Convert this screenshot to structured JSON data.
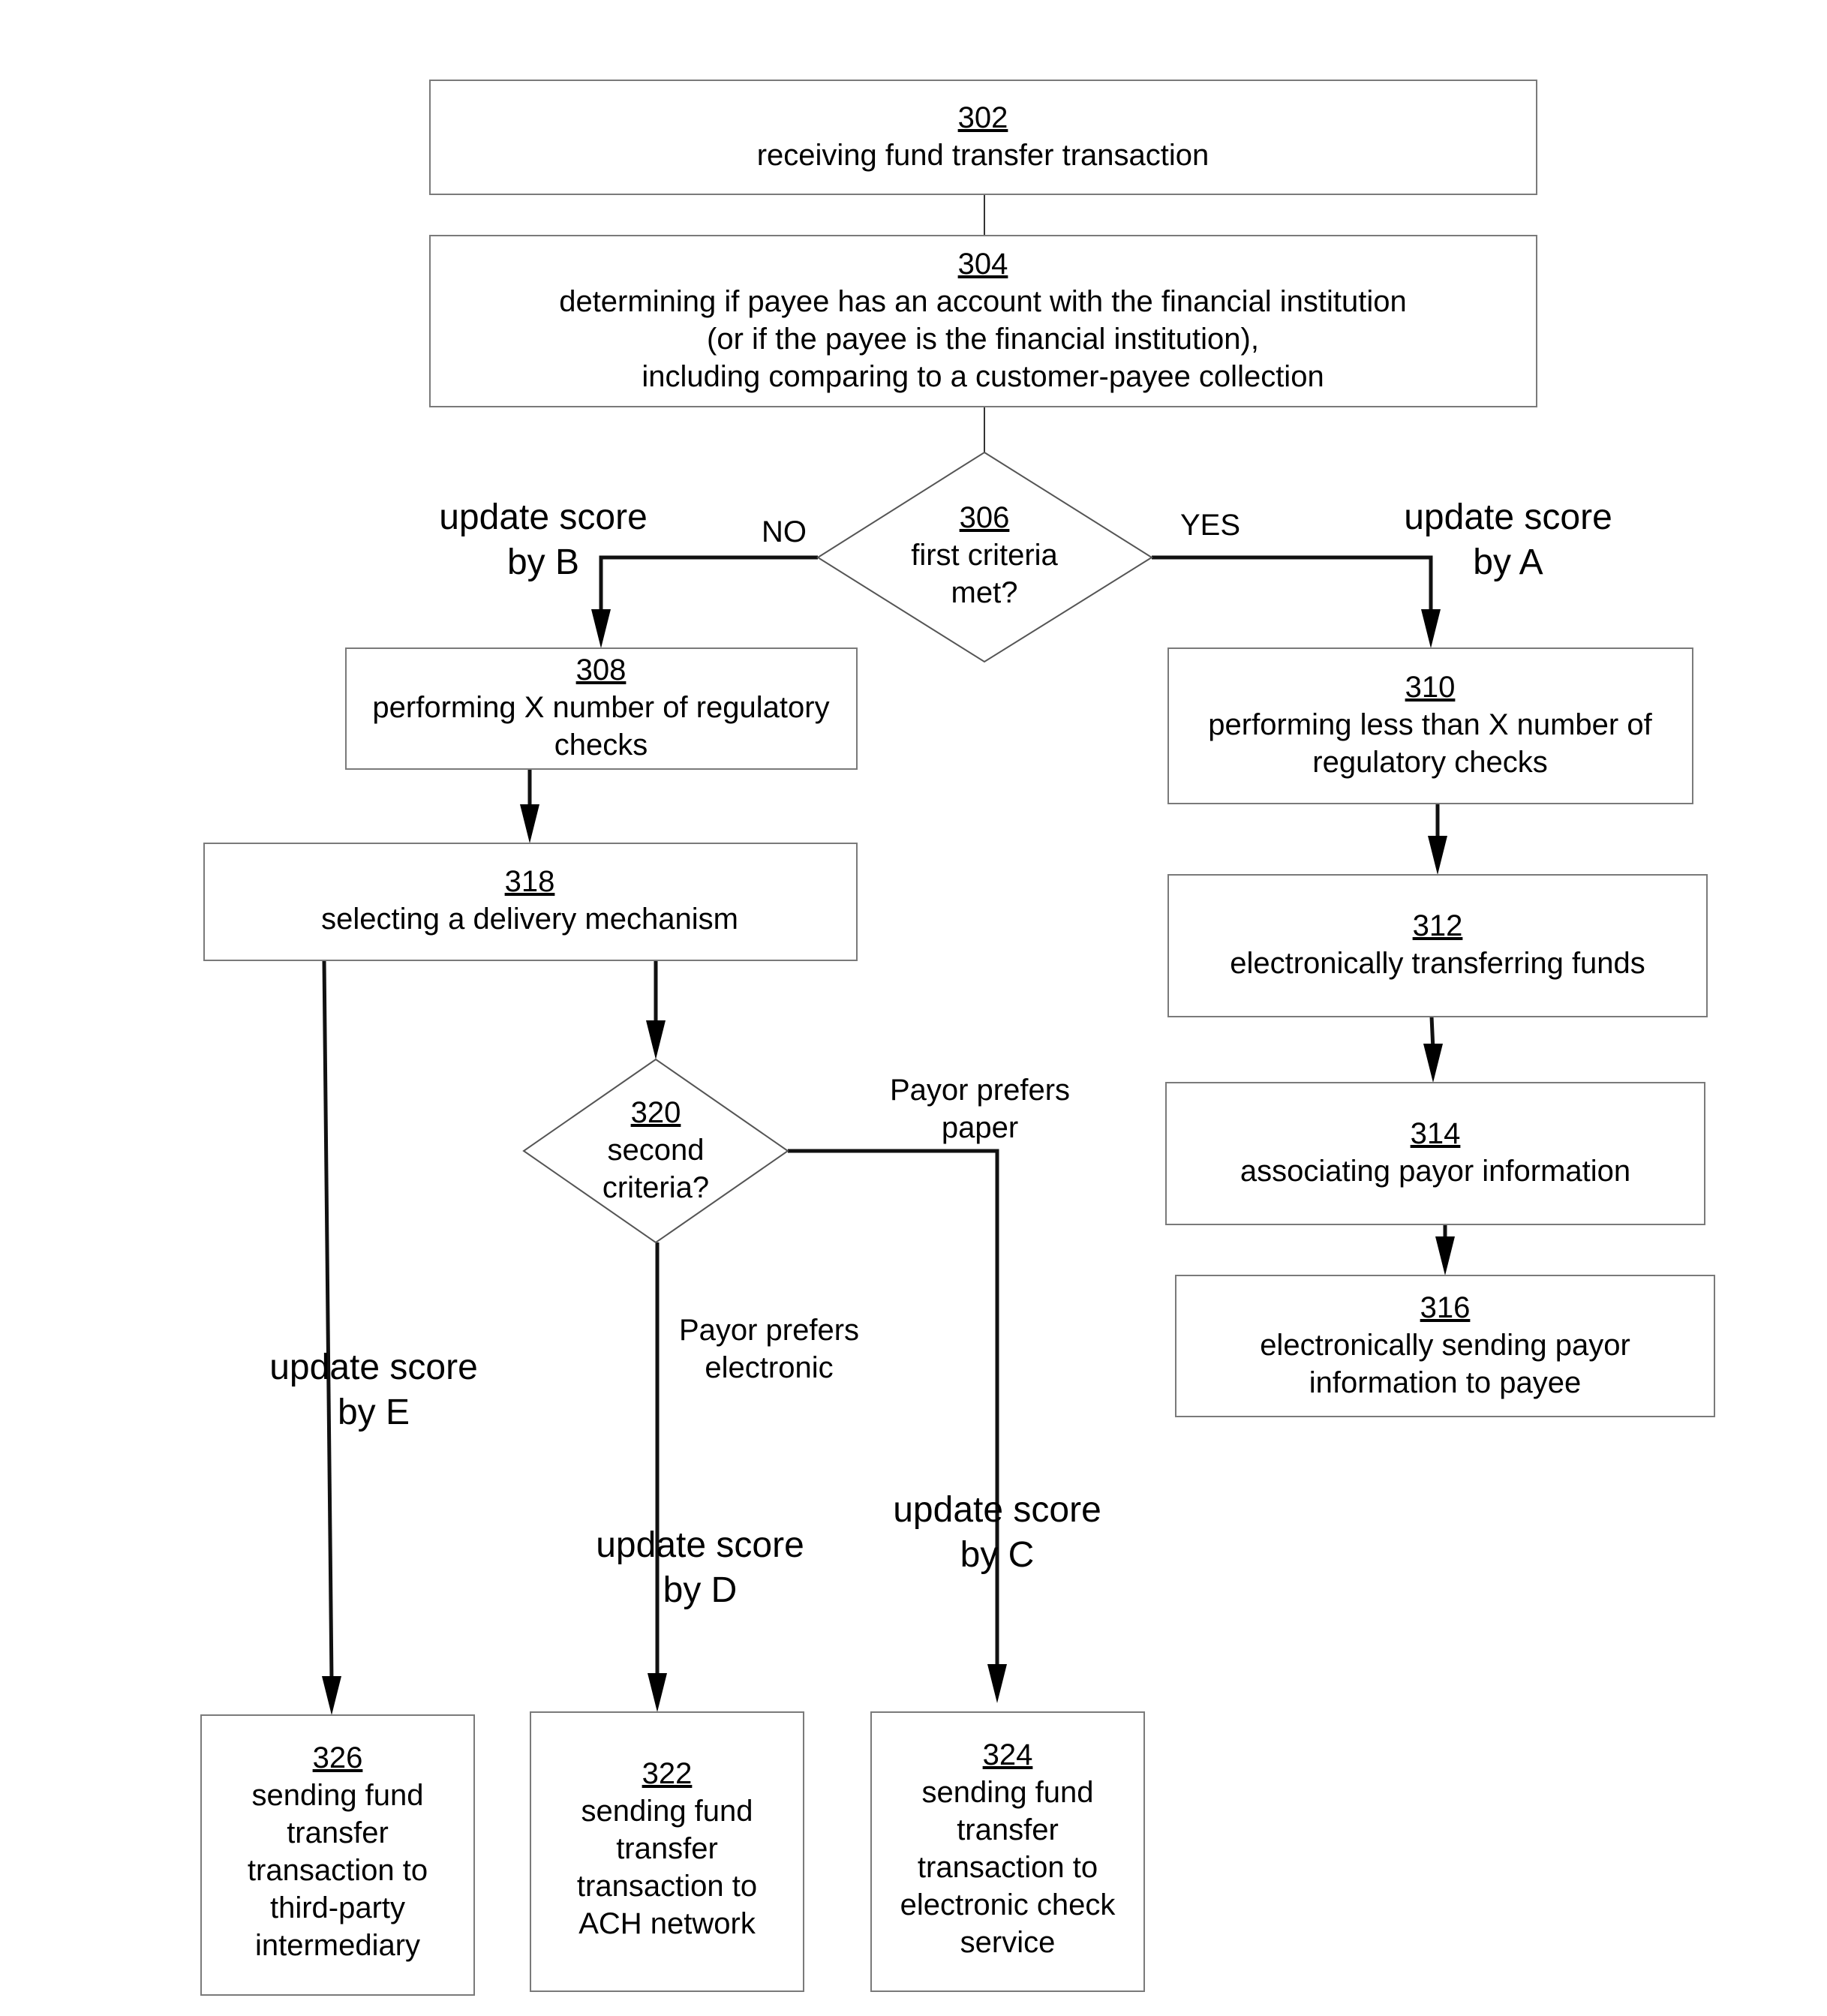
{
  "figure": {
    "nodes": {
      "n302": {
        "id": "302",
        "lines": [
          "receiving fund transfer transaction"
        ]
      },
      "n304": {
        "id": "304",
        "lines": [
          "determining if payee has an account with the financial institution",
          "(or if the payee is the financial institution),",
          "including comparing to a customer-payee collection"
        ]
      },
      "n306": {
        "id": "306",
        "lines": [
          "first criteria",
          "met?"
        ]
      },
      "n308": {
        "id": "308",
        "lines": [
          "performing X number of regulatory",
          "checks"
        ]
      },
      "n310": {
        "id": "310",
        "lines": [
          "performing less than X number of",
          "regulatory checks"
        ]
      },
      "n312": {
        "id": "312",
        "lines": [
          "electronically transferring funds"
        ]
      },
      "n314": {
        "id": "314",
        "lines": [
          "associating payor information"
        ]
      },
      "n316": {
        "id": "316",
        "lines": [
          "electronically sending payor",
          "information to payee"
        ]
      },
      "n318": {
        "id": "318",
        "lines": [
          "selecting a delivery mechanism"
        ]
      },
      "n320": {
        "id": "320",
        "lines": [
          "second",
          "criteria?"
        ]
      },
      "n322": {
        "id": "322",
        "lines": [
          "sending fund",
          "transfer",
          "transaction to",
          "ACH network"
        ]
      },
      "n324": {
        "id": "324",
        "lines": [
          "sending fund",
          "transfer",
          "transaction to",
          "electronic check",
          "service"
        ]
      },
      "n326": {
        "id": "326",
        "lines": [
          "sending fund",
          "transfer",
          "transaction to",
          "third-party",
          "intermediary"
        ]
      }
    },
    "edge_labels": {
      "no": "NO",
      "yes": "YES",
      "score_b": [
        "update score",
        "by B"
      ],
      "score_a": [
        "update score",
        "by A"
      ],
      "paper": [
        "Payor prefers",
        "paper"
      ],
      "electronic": [
        "Payor prefers",
        "electronic"
      ],
      "score_e": [
        "update score",
        "by E"
      ],
      "score_d": [
        "update score",
        "by D"
      ],
      "score_c": [
        "update score",
        "by C"
      ]
    }
  }
}
